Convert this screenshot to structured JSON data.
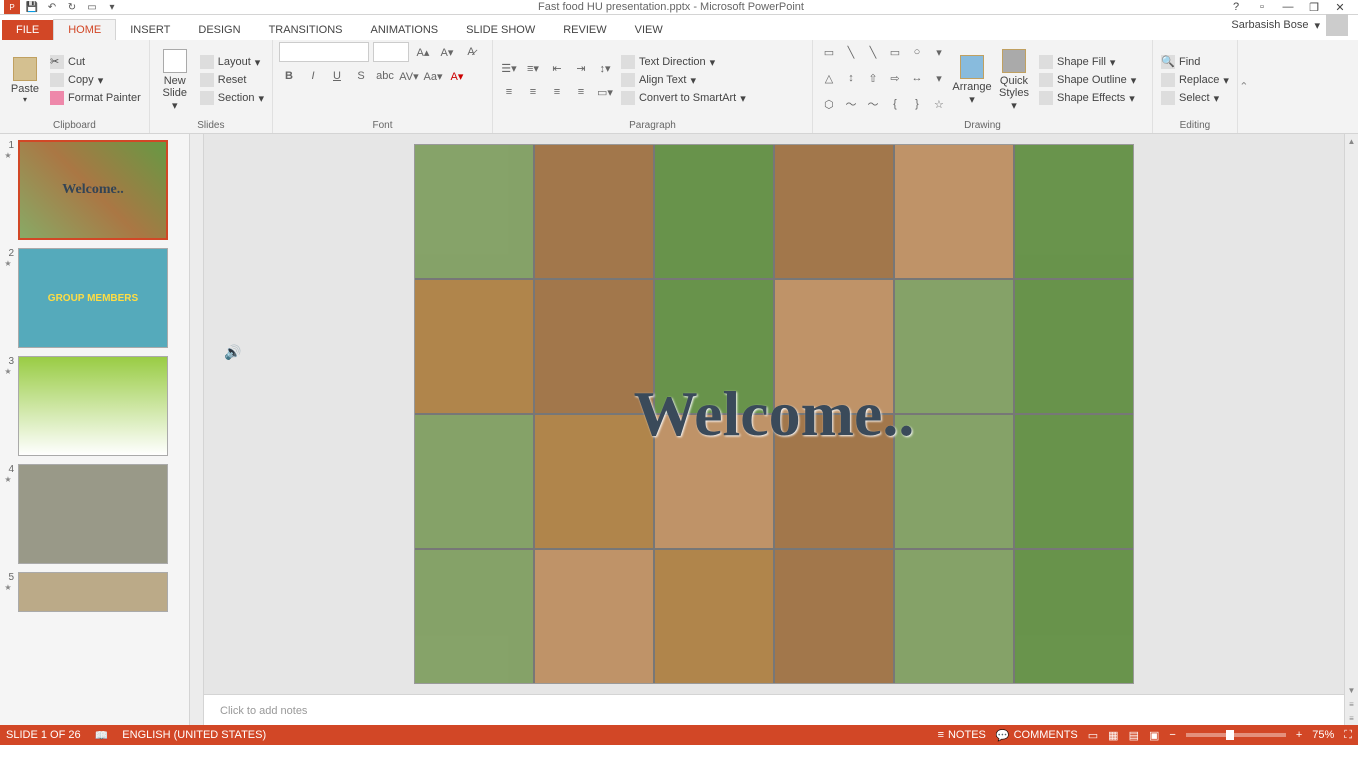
{
  "title": "Fast food HU presentation.pptx - Microsoft PowerPoint",
  "account": "Sarbasish Bose",
  "tabs": {
    "file": "FILE",
    "home": "HOME",
    "insert": "INSERT",
    "design": "DESIGN",
    "transitions": "TRANSITIONS",
    "animations": "ANIMATIONS",
    "slideshow": "SLIDE SHOW",
    "review": "REVIEW",
    "view": "VIEW"
  },
  "clipboard": {
    "paste": "Paste",
    "cut": "Cut",
    "copy": "Copy",
    "format_painter": "Format Painter",
    "label": "Clipboard"
  },
  "slides": {
    "new_slide": "New\nSlide",
    "layout": "Layout",
    "reset": "Reset",
    "section": "Section",
    "label": "Slides"
  },
  "font": {
    "label": "Font"
  },
  "paragraph": {
    "text_direction": "Text Direction",
    "align_text": "Align Text",
    "convert_smartart": "Convert to SmartArt",
    "label": "Paragraph"
  },
  "drawing": {
    "arrange": "Arrange",
    "quick_styles": "Quick\nStyles",
    "shape_fill": "Shape Fill",
    "shape_outline": "Shape Outline",
    "shape_effects": "Shape Effects",
    "label": "Drawing"
  },
  "editing": {
    "find": "Find",
    "replace": "Replace",
    "select": "Select",
    "label": "Editing"
  },
  "slide_welcome": "Welcome..",
  "thumb2_title": "GROUP MEMBERS",
  "notes_placeholder": "Click to add notes",
  "status": {
    "slide_info": "SLIDE 1 OF 26",
    "language": "ENGLISH (UNITED STATES)",
    "notes": "NOTES",
    "comments": "COMMENTS",
    "zoom": "75%"
  },
  "thumb_nums": [
    "1",
    "2",
    "3",
    "4",
    "5"
  ]
}
